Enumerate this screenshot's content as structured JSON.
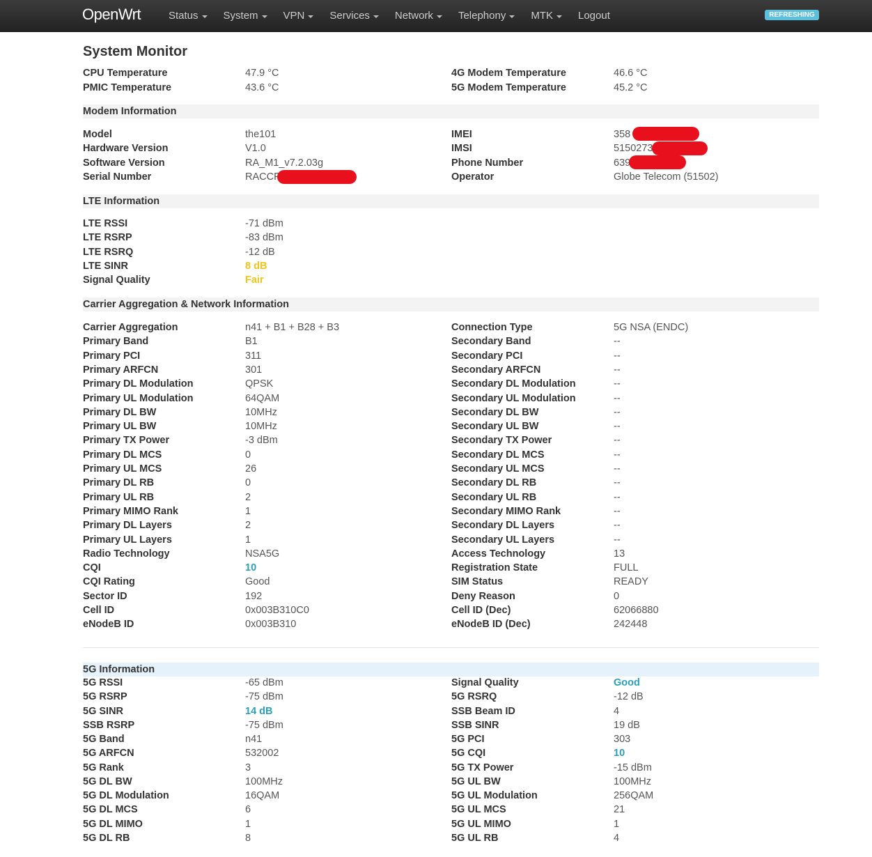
{
  "navbar": {
    "brand": "OpenWrt",
    "menu": [
      "Status",
      "System",
      "VPN",
      "Services",
      "Network",
      "Telephony",
      "MTK",
      "Logout"
    ],
    "badge": "REFRESHING"
  },
  "page_title": "System Monitor",
  "temperature": [
    {
      "l1": "CPU Temperature",
      "v1": "47.9 °C",
      "l2": "4G Modem Temperature",
      "v2": "46.6 °C"
    },
    {
      "l1": "PMIC Temperature",
      "v1": "43.6 °C",
      "l2": "5G Modem Temperature",
      "v2": "45.2 °C"
    }
  ],
  "modem": {
    "title": "Modem Information",
    "rows": [
      {
        "l1": "Model",
        "v1": "the101",
        "l2": "IMEI",
        "v2": "358"
      },
      {
        "l1": "Hardware Version",
        "v1": "V1.0",
        "l2": "IMSI",
        "v2": "5150273"
      },
      {
        "l1": "Software Version",
        "v1": "RA_M1_v7.2.03g",
        "l2": "Phone Number",
        "v2": "639"
      },
      {
        "l1": "Serial Number",
        "v1": "RACCF",
        "l2": "Operator",
        "v2": "Globe Telecom (51502)"
      }
    ]
  },
  "lte": {
    "title": "LTE Information",
    "rows": [
      {
        "l1": "LTE RSSI",
        "v1": "-71 dBm"
      },
      {
        "l1": "LTE RSRP",
        "v1": "-83 dBm"
      },
      {
        "l1": "LTE RSRQ",
        "v1": "-12 dB"
      },
      {
        "l1": "LTE SINR",
        "v1": "8 dB",
        "c1": "yellow"
      },
      {
        "l1": "Signal Quality",
        "v1": "Fair",
        "c1": "yellow"
      }
    ]
  },
  "carrier": {
    "title": "Carrier Aggregation & Network Information",
    "rows": [
      {
        "l1": "Carrier Aggregation",
        "v1": "n41 + B1 + B28 + B3",
        "l2": "Connection Type",
        "v2": "5G NSA (ENDC)"
      },
      {
        "l1": "Primary Band",
        "v1": "B1",
        "l2": "Secondary Band",
        "v2": "--"
      },
      {
        "l1": "Primary PCI",
        "v1": "311",
        "l2": "Secondary PCI",
        "v2": "--"
      },
      {
        "l1": "Primary ARFCN",
        "v1": "301",
        "l2": "Secondary ARFCN",
        "v2": "--"
      },
      {
        "l1": "Primary DL Modulation",
        "v1": "QPSK",
        "l2": "Secondary DL Modulation",
        "v2": "--"
      },
      {
        "l1": "Primary UL Modulation",
        "v1": "64QAM",
        "l2": "Secondary UL Modulation",
        "v2": "--"
      },
      {
        "l1": "Primary DL BW",
        "v1": "10MHz",
        "l2": "Secondary DL BW",
        "v2": "--"
      },
      {
        "l1": "Primary UL BW",
        "v1": "10MHz",
        "l2": "Secondary UL BW",
        "v2": "--"
      },
      {
        "l1": "Primary TX Power",
        "v1": "-3 dBm",
        "l2": "Secondary TX Power",
        "v2": "--"
      },
      {
        "l1": "Primary DL MCS",
        "v1": "0",
        "l2": "Secondary DL MCS",
        "v2": "--"
      },
      {
        "l1": "Primary UL MCS",
        "v1": "26",
        "l2": "Secondary UL MCS",
        "v2": "--"
      },
      {
        "l1": "Primary DL RB",
        "v1": "0",
        "l2": "Secondary DL RB",
        "v2": "--"
      },
      {
        "l1": "Primary UL RB",
        "v1": "2",
        "l2": "Secondary UL RB",
        "v2": "--"
      },
      {
        "l1": "Primary MIMO Rank",
        "v1": "1",
        "l2": "Secondary MIMO Rank",
        "v2": "--"
      },
      {
        "l1": "Primary DL Layers",
        "v1": "2",
        "l2": "Secondary DL Layers",
        "v2": "--"
      },
      {
        "l1": "Primary UL Layers",
        "v1": "1",
        "l2": "Secondary UL Layers",
        "v2": "--"
      },
      {
        "l1": "Radio Technology",
        "v1": "NSA5G",
        "l2": "Access Technology",
        "v2": "13"
      },
      {
        "l1": "CQI",
        "v1": "10",
        "c1": "teal",
        "l2": "Registration State",
        "v2": "FULL"
      },
      {
        "l1": "CQI Rating",
        "v1": "Good",
        "l2": "SIM Status",
        "v2": "READY"
      },
      {
        "l1": "Sector ID",
        "v1": "192",
        "l2": "Deny Reason",
        "v2": "0"
      },
      {
        "l1": "Cell ID",
        "v1": "0x003B310C0",
        "l2": "Cell ID (Dec)",
        "v2": "62066880"
      },
      {
        "l1": "eNodeB ID",
        "v1": "0x003B310",
        "l2": "eNodeB ID (Dec)",
        "v2": "242448"
      }
    ]
  },
  "fiveg": {
    "title": "5G Information",
    "rows": [
      {
        "l1": "5G RSSI",
        "v1": "-65 dBm",
        "l2": "Signal Quality",
        "v2": "Good",
        "c2": "teal"
      },
      {
        "l1": "5G RSRP",
        "v1": "-75 dBm",
        "l2": "5G RSRQ",
        "v2": "-12 dB"
      },
      {
        "l1": "5G SINR",
        "v1": "14 dB",
        "c1": "teal",
        "l2": "SSB Beam ID",
        "v2": "4"
      },
      {
        "l1": "SSB RSRP",
        "v1": "-75 dBm",
        "l2": "SSB SINR",
        "v2": "19 dB"
      },
      {
        "l1": "5G Band",
        "v1": "n41",
        "l2": "5G PCI",
        "v2": "303"
      },
      {
        "l1": "5G ARFCN",
        "v1": "532002",
        "l2": "5G CQI",
        "v2": "10",
        "c2": "teal"
      },
      {
        "l1": "5G Rank",
        "v1": "3",
        "l2": "5G TX Power",
        "v2": "-15 dBm"
      },
      {
        "l1": "5G DL BW",
        "v1": "100MHz",
        "l2": "5G UL BW",
        "v2": "100MHz"
      },
      {
        "l1": "5G DL Modulation",
        "v1": "16QAM",
        "l2": "5G UL Modulation",
        "v2": "256QAM"
      },
      {
        "l1": "5G DL MCS",
        "v1": "6",
        "l2": "5G UL MCS",
        "v2": "21"
      },
      {
        "l1": "5G DL MIMO",
        "v1": "1",
        "l2": "5G UL MIMO",
        "v2": "1"
      },
      {
        "l1": "5G DL RB",
        "v1": "8",
        "l2": "5G UL RB",
        "v2": "4"
      }
    ]
  },
  "colors": {
    "yellow": "#f0c419",
    "teal": "#2a9fbc",
    "navbar": "#2d2d2d",
    "badge": "#5bc0de",
    "redaction": "#e8101c"
  }
}
